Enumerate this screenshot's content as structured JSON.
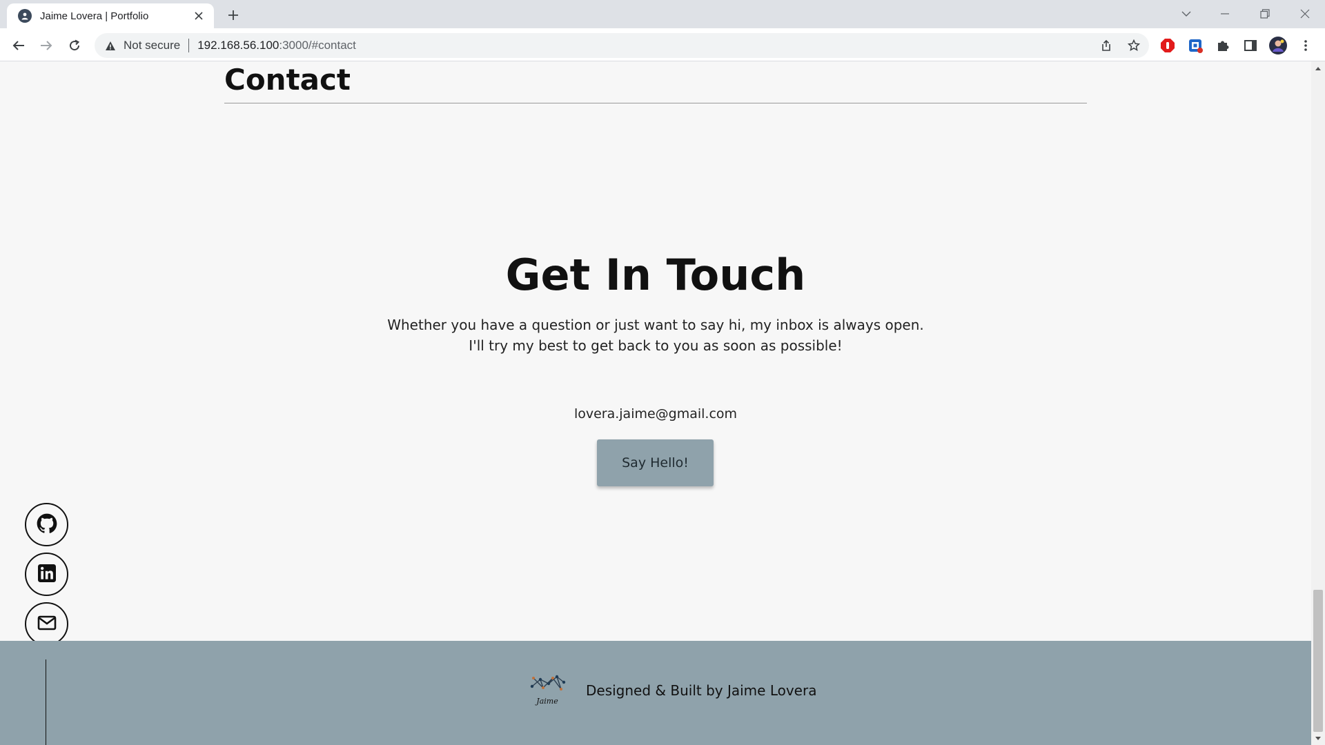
{
  "browser": {
    "tab_title": "Jaime Lovera | Portfolio",
    "security_label": "Not secure",
    "url_host": "192.168.56.100",
    "url_rest": ":3000/#contact"
  },
  "page": {
    "section_title": "Contact",
    "headline": "Get In Touch",
    "body_line1": "Whether you have a question or just want to say hi, my inbox is always open.",
    "body_line2": "I'll try my best to get back to you as soon as possible!",
    "email": "lovera.jaime@gmail.com",
    "cta_label": "Say Hello!",
    "social_links": [
      "github-icon",
      "linkedin-icon",
      "mail-icon"
    ],
    "footer_logo_text": "Jaime",
    "footer_text": "Designed & Built by Jaime Lovera"
  },
  "colors": {
    "accent": "#8fa2ab",
    "page_background": "#f7f7f7",
    "text": "#111111"
  }
}
